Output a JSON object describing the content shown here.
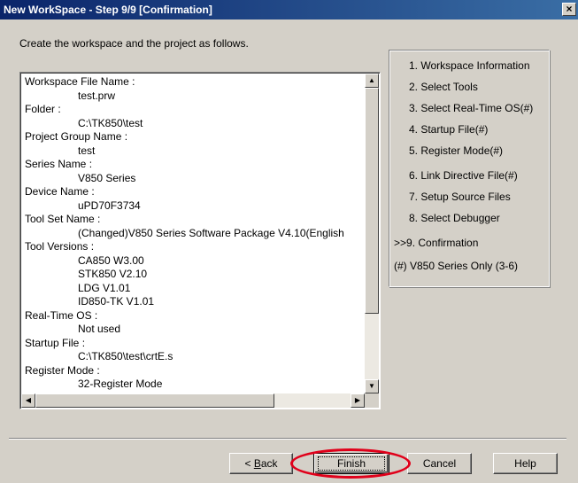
{
  "window": {
    "title": "New WorkSpace - Step 9/9 [Confirmation]",
    "close_glyph": "×"
  },
  "intro": "Create the workspace and the project as follows.",
  "summary": [
    {
      "label": "Workspace File Name :",
      "values": [
        "test.prw"
      ]
    },
    {
      "label": "Folder :",
      "values": [
        "C:\\TK850\\test"
      ]
    },
    {
      "label": "Project Group Name :",
      "values": [
        "test"
      ]
    },
    {
      "label": "Series Name :",
      "values": [
        "V850 Series"
      ]
    },
    {
      "label": "Device Name :",
      "values": [
        "uPD70F3734"
      ]
    },
    {
      "label": "Tool Set Name :",
      "values": [
        "(Changed)V850 Series Software Package V4.10(English"
      ]
    },
    {
      "label": "Tool Versions :",
      "values": [
        "CA850 W3.00",
        "STK850 V2.10",
        "LDG V1.01",
        "ID850-TK V1.01"
      ]
    },
    {
      "label": "Real-Time OS :",
      "values": [
        "Not used"
      ]
    },
    {
      "label": "Startup File :",
      "values": [
        "C:\\TK850\\test\\crtE.s"
      ]
    },
    {
      "label": "Register Mode :",
      "values": [
        "32-Register Mode"
      ]
    }
  ],
  "steps": [
    "1. Workspace Information",
    "2. Select Tools",
    "3. Select Real-Time OS(#)",
    "4. Startup File(#)",
    "5. Register Mode(#)",
    "6. Link Directive File(#)",
    "7. Setup Source Files",
    "8. Select Debugger",
    ">>9. Confirmation",
    "(#) V850 Series Only (3-6)"
  ],
  "buttons": {
    "back_prefix": "< ",
    "back_accel": "B",
    "back_rest": "ack",
    "finish": "Finish",
    "cancel": "Cancel",
    "help": "Help"
  },
  "colors": {
    "highlight": "#e0001a",
    "titlebar": "#0a246a"
  }
}
